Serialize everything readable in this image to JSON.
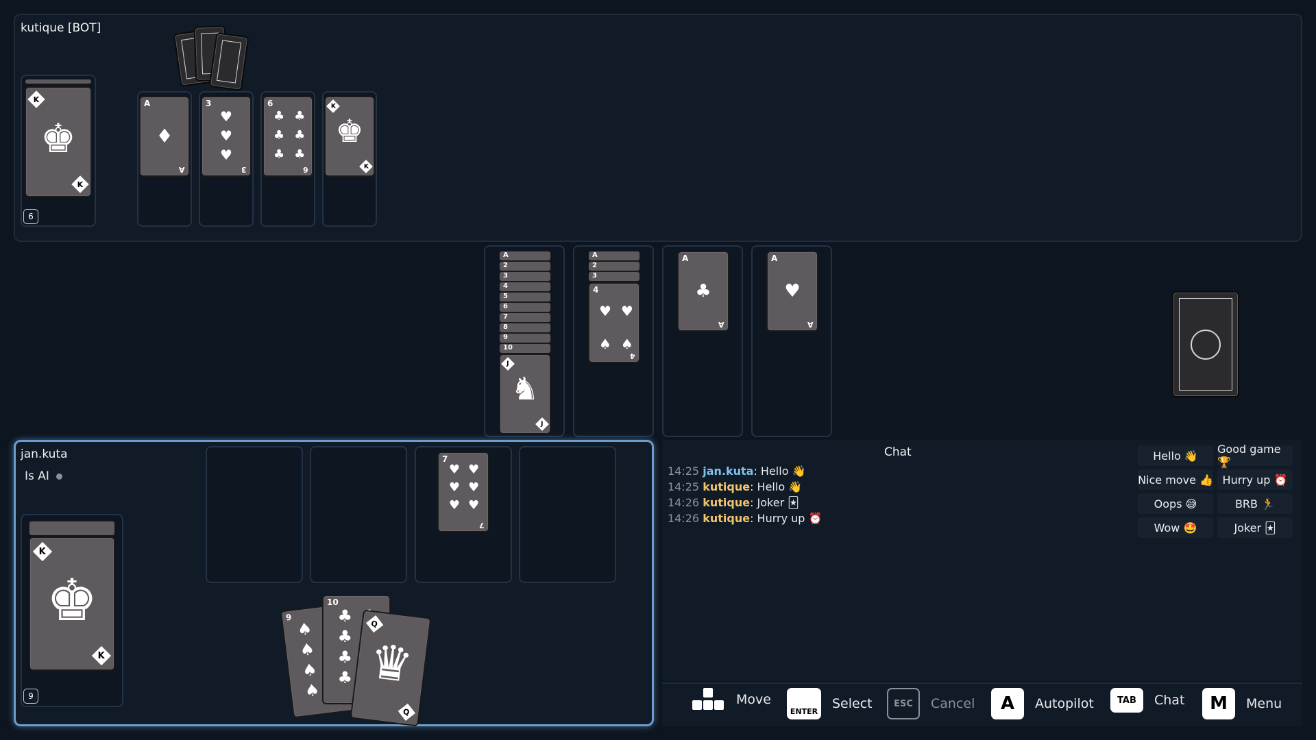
{
  "opponent": {
    "name": "kutique [BOT]",
    "pile_count": "6",
    "pile_top": {
      "rank": "K",
      "suit": "♦"
    },
    "discards": [
      {
        "rank": "A",
        "suit": "♦"
      },
      {
        "rank": "3",
        "suit": "♥"
      },
      {
        "rank": "6",
        "suit": "♣"
      },
      {
        "rank": "K",
        "suit": "♣"
      }
    ]
  },
  "build_piles": [
    {
      "ranks": [
        "A",
        "2",
        "3",
        "4",
        "5",
        "6",
        "7",
        "8",
        "9",
        "10"
      ],
      "top": {
        "rank": "J",
        "suit": "♦"
      }
    },
    {
      "ranks": [
        "A",
        "2",
        "3"
      ],
      "top": {
        "rank": "4",
        "suit": "♥"
      }
    },
    {
      "ranks": [],
      "top": {
        "rank": "A",
        "suit": "♣"
      }
    },
    {
      "ranks": [],
      "top": {
        "rank": "A",
        "suit": "♥"
      }
    }
  ],
  "player": {
    "name": "jan.kuta",
    "is_ai_label": "Is AI",
    "pile_count": "9",
    "pile_top": {
      "rank": "K",
      "suit": "♦"
    },
    "discards": [
      null,
      null,
      {
        "rank": "7",
        "suit": "♥"
      },
      null
    ],
    "hand": [
      {
        "rank": "9",
        "suit": "♠"
      },
      {
        "rank": "10",
        "suit": "♣"
      },
      {
        "rank": "Q",
        "suit": "♣"
      }
    ]
  },
  "chat": {
    "title": "Chat",
    "messages": [
      {
        "time": "14:25",
        "user": "jan.kuta",
        "user_color": "#7fc4ef",
        "text": "Hello 👋"
      },
      {
        "time": "14:25",
        "user": "kutique",
        "user_color": "#f2c56b",
        "text": "Hello 👋"
      },
      {
        "time": "14:26",
        "user": "kutique",
        "user_color": "#f2c56b",
        "text": "Joker 🃏"
      },
      {
        "time": "14:26",
        "user": "kutique",
        "user_color": "#f2c56b",
        "text": "Hurry up ⏰"
      }
    ],
    "quick_replies": [
      "Hello 👋",
      "Good game 🏆",
      "Nice move 👍",
      "Hurry up ⏰",
      "Oops 😅",
      "BRB 🏃",
      "Wow 🤩",
      "Joker 🃏"
    ]
  },
  "controls": [
    {
      "key": "",
      "label": "Move",
      "icon": "dpad-icon"
    },
    {
      "key": "ENTER",
      "label": "Select"
    },
    {
      "key": "ESC",
      "label": "Cancel"
    },
    {
      "key": "A",
      "label": "Autopilot"
    },
    {
      "key": "TAB",
      "label": "Chat"
    },
    {
      "key": "M",
      "label": "Menu"
    }
  ],
  "colors": {
    "accent": "#6a9ed0",
    "card": "#5f5a5d",
    "panel": "#111a27",
    "bg": "#0d1520"
  }
}
